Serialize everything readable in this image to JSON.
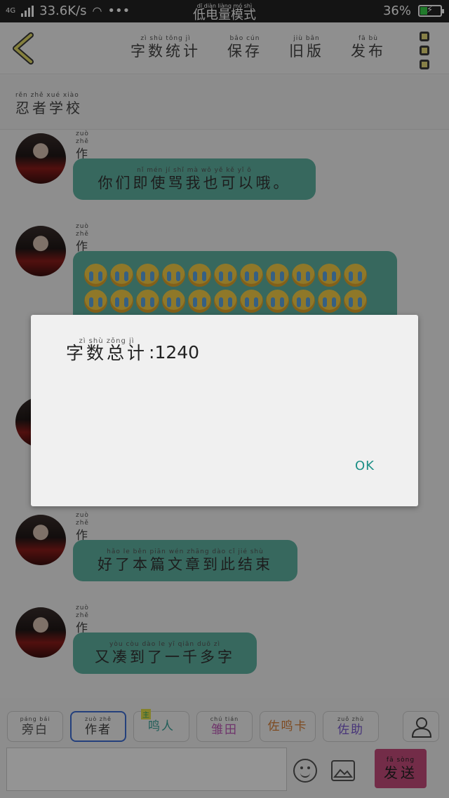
{
  "status_bar": {
    "network": "4G",
    "speed": "33.6K/s",
    "dots": "•••",
    "mode_pinyin": "dī diàn liàng mó shì",
    "mode": "低电量模式",
    "battery": "36%",
    "battery_level": 0.36
  },
  "top_bar": {
    "actions": [
      {
        "pinyin": "zì shù tǒng jì",
        "label": "字数统计"
      },
      {
        "pinyin": "bǎo cún",
        "label": "保存"
      },
      {
        "pinyin": "jiù bǎn",
        "label": "旧版"
      },
      {
        "pinyin": "fā bù",
        "label": "发布"
      }
    ]
  },
  "school": {
    "pinyin": "rěn zhě xué xiào",
    "label": "忍者学校"
  },
  "messages": [
    {
      "author_pinyin": "zuò zhě",
      "author": "作者",
      "text_pinyin": "nǐ mén jí shǐ mà wǒ yě kě yǐ ō",
      "text": "你们即使骂我也可以哦。"
    },
    {
      "author_pinyin": "zuò zhě",
      "author": "作者",
      "emoji_count": 22
    },
    {
      "author_pinyin": "zuò zhě",
      "author": "作者",
      "text_pinyin": "hǎo le běn piān wén zhāng dào cǐ jié shù",
      "text": "好了本篇文章到此结束"
    },
    {
      "author_pinyin": "zuò zhě",
      "author": "作者",
      "text_pinyin": "yòu còu dào le yī qiān duō zì",
      "text": "又凑到了一千多字"
    }
  ],
  "dialog": {
    "label_pinyin": "zì shù zǒng jì",
    "label": "字数总计",
    "value": ":1240",
    "ok": "OK"
  },
  "bottom": {
    "tabs": [
      {
        "pinyin": "páng bái",
        "label": "旁白",
        "color": "#555555"
      },
      {
        "pinyin": "zuò zhě",
        "label": "作者",
        "color": "#444444"
      },
      {
        "pinyin": "",
        "label": "鸣人",
        "color": "#3aa39a",
        "tag": "主"
      },
      {
        "pinyin": "chú tián",
        "label": "雏田",
        "color": "#c05ab8"
      },
      {
        "pinyin": "",
        "label": "佐鸣卡",
        "color": "#d9813a"
      },
      {
        "pinyin": "zuǒ zhù",
        "label": "佐助",
        "color": "#7a5bd0"
      }
    ],
    "send_pinyin": "fā sòng",
    "send": "发送"
  }
}
